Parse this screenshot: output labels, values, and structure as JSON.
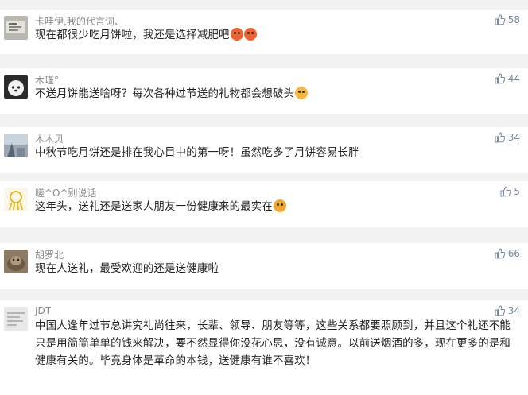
{
  "comments": [
    {
      "username": "卡哇伊,我的代言词、",
      "likes": "58",
      "text": "现在都很少吃月饼啦，我还是选择减肥吧",
      "emojis": [
        "angry",
        "angry"
      ]
    },
    {
      "username": "木瑾°",
      "likes": "44",
      "text": "不送月饼能送啥呀？每次各种过节送的礼物都会想破头",
      "emojis": [
        "yawn"
      ]
    },
    {
      "username": "木木贝",
      "likes": "34",
      "text": "中秋节吃月饼还是排在我心目中的第一呀！虽然吃多了月饼容易长胖",
      "emojis": []
    },
    {
      "username": "嗟^O^别说话",
      "likes": "5",
      "text": "这年头，送礼还是送家人朋友一份健康来的最实在",
      "emojis": [
        "money"
      ]
    },
    {
      "username": "胡罗北",
      "likes": "66",
      "text": "现在人送礼，最受欢迎的还是送健康啦",
      "emojis": []
    },
    {
      "username": "JDT",
      "likes": "34",
      "text": "中国人逢年过节总讲究礼尚往来，长辈、领导、朋友等等，这些关系都要照顾到，并且这个礼还不能只是用简简单单的钱来解决，要不然显得你没花心思，没有诚意。以前送烟酒的多，现在更多的是和健康有关的。毕竟身体是革命的本钱，送健康有谁不喜欢！",
      "emojis": []
    }
  ],
  "icons": {
    "like": "thumbs-up-icon"
  }
}
